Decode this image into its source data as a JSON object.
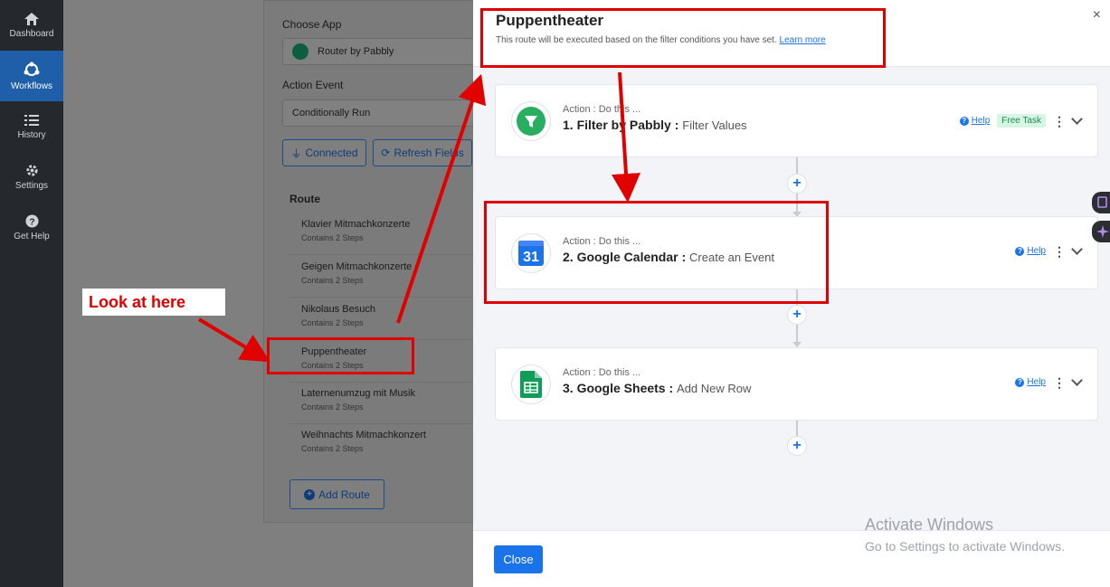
{
  "nav": {
    "items": [
      {
        "label": "Dashboard",
        "icon": "home-icon",
        "active": false
      },
      {
        "label": "Workflows",
        "icon": "workflow-icon",
        "active": true
      },
      {
        "label": "History",
        "icon": "history-icon",
        "active": false
      },
      {
        "label": "Settings",
        "icon": "gear-icon",
        "active": false
      },
      {
        "label": "Get Help",
        "icon": "help-icon",
        "active": false
      }
    ]
  },
  "background": {
    "choose_app_label": "Choose App",
    "choose_app_value": "Router by Pabbly",
    "action_event_label": "Action Event",
    "action_event_value": "Conditionally Run",
    "connected_btn": "Connected",
    "refresh_btn": "Refresh Fields",
    "route_title": "Route",
    "routes": [
      {
        "name": "Klavier Mitmachkonzerte",
        "sub": "Contains 2 Steps"
      },
      {
        "name": "Geigen Mitmachkonzerte",
        "sub": "Contains 2 Steps"
      },
      {
        "name": "Nikolaus Besuch",
        "sub": "Contains 2 Steps"
      },
      {
        "name": "Puppentheater",
        "sub": "Contains 2 Steps"
      },
      {
        "name": "Laternenumzug mit Musik",
        "sub": "Contains 2 Steps"
      },
      {
        "name": "Weihnachts Mitmachkonzert",
        "sub": "Contains 2 Steps"
      }
    ],
    "add_route_btn": "Add Route"
  },
  "modal": {
    "title": "Puppentheater",
    "description": "This route will be executed based on the filter conditions you have set.",
    "learn_more": "Learn more",
    "close_x": "×",
    "actions": [
      {
        "label": "Action : Do this ...",
        "app": "1. Filter by Pabbly :",
        "event": "Filter Values",
        "help": "Help",
        "badge": "Free Task",
        "icon": "filter-icon"
      },
      {
        "label": "Action : Do this ...",
        "app": "2. Google Calendar :",
        "event": "Create an Event",
        "help": "Help",
        "badge": "",
        "icon": "google-calendar-icon",
        "calendar_number": "31"
      },
      {
        "label": "Action : Do this ...",
        "app": "3. Google Sheets :",
        "event": "Add New Row",
        "help": "Help",
        "badge": "",
        "icon": "google-sheets-icon"
      }
    ],
    "plus": "+",
    "close_btn": "Close"
  },
  "annotation": {
    "callout": "Look at here"
  },
  "watermark": {
    "line1": "Activate Windows",
    "line2": "Go to Settings to activate Windows."
  },
  "colors": {
    "accent": "#1a73e8",
    "annotation_red": "#e00000",
    "nav_bg": "#25282d",
    "nav_active": "#1f5ea8"
  }
}
